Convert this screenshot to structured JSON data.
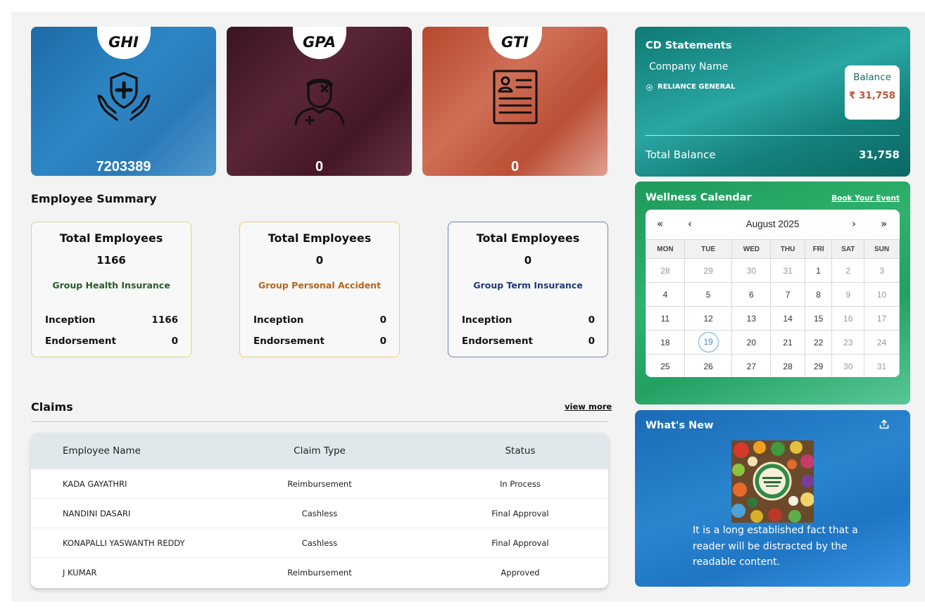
{
  "products": [
    {
      "code": "GHI",
      "value": "7203389",
      "icon": "health-shield-hands-icon"
    },
    {
      "code": "GPA",
      "value": "0",
      "icon": "injured-person-icon"
    },
    {
      "code": "GTI",
      "value": "0",
      "icon": "document-profile-icon"
    }
  ],
  "employee_summary": {
    "title": "Employee Summary",
    "cards": [
      {
        "title": "Total Employees",
        "count": "1166",
        "policy": "Group Health Insurance",
        "inception_label": "Inception",
        "inception": "1166",
        "endorsement_label": "Endorsement",
        "endorsement": "0"
      },
      {
        "title": "Total Employees",
        "count": "0",
        "policy": "Group Personal Accident",
        "inception_label": "Inception",
        "inception": "0",
        "endorsement_label": "Endorsement",
        "endorsement": "0"
      },
      {
        "title": "Total Employees",
        "count": "0",
        "policy": "Group Term Insurance",
        "inception_label": "Inception",
        "inception": "0",
        "endorsement_label": "Endorsement",
        "endorsement": "0"
      }
    ]
  },
  "claims": {
    "title": "Claims",
    "view_more": "view more",
    "columns": [
      "Employee Name",
      "Claim Type",
      "Status"
    ],
    "rows": [
      [
        "KADA GAYATHRI",
        "Reimbursement",
        "In Process"
      ],
      [
        "NANDINI DASARI",
        "Cashless",
        "Final Approval"
      ],
      [
        "KONAPALLI YASWANTH REDDY",
        "Cashless",
        "Final Approval"
      ],
      [
        "J KUMAR",
        "Reimbursement",
        "Approved"
      ]
    ]
  },
  "cd_statements": {
    "title": "CD Statements",
    "company_label": "Company Name",
    "company": "RELIANCE GENERAL",
    "balance_label": "Balance",
    "balance_value": "₹ 31,758",
    "total_label": "Total Balance",
    "total_value": "31,758"
  },
  "wellness": {
    "title": "Wellness Calendar",
    "book_link": "Book Your Event",
    "month": "August 2025",
    "nav": {
      "prev_year": "«",
      "prev_month": "‹",
      "next_month": "›",
      "next_year": "»"
    },
    "weekdays": [
      "MON",
      "TUE",
      "WED",
      "THU",
      "FRI",
      "SAT",
      "SUN"
    ],
    "weeks": [
      [
        "28",
        "29",
        "30",
        "31",
        "1",
        "2",
        "3"
      ],
      [
        "4",
        "5",
        "6",
        "7",
        "8",
        "9",
        "10"
      ],
      [
        "11",
        "12",
        "13",
        "14",
        "15",
        "16",
        "17"
      ],
      [
        "18",
        "19",
        "20",
        "21",
        "22",
        "23",
        "24"
      ],
      [
        "25",
        "26",
        "27",
        "28",
        "29",
        "30",
        "31"
      ]
    ],
    "selected_day": "19"
  },
  "whats_new": {
    "title": "What's New",
    "share_icon": "share-icon",
    "text": "It is a long established fact that a reader will be distracted by the readable content."
  }
}
